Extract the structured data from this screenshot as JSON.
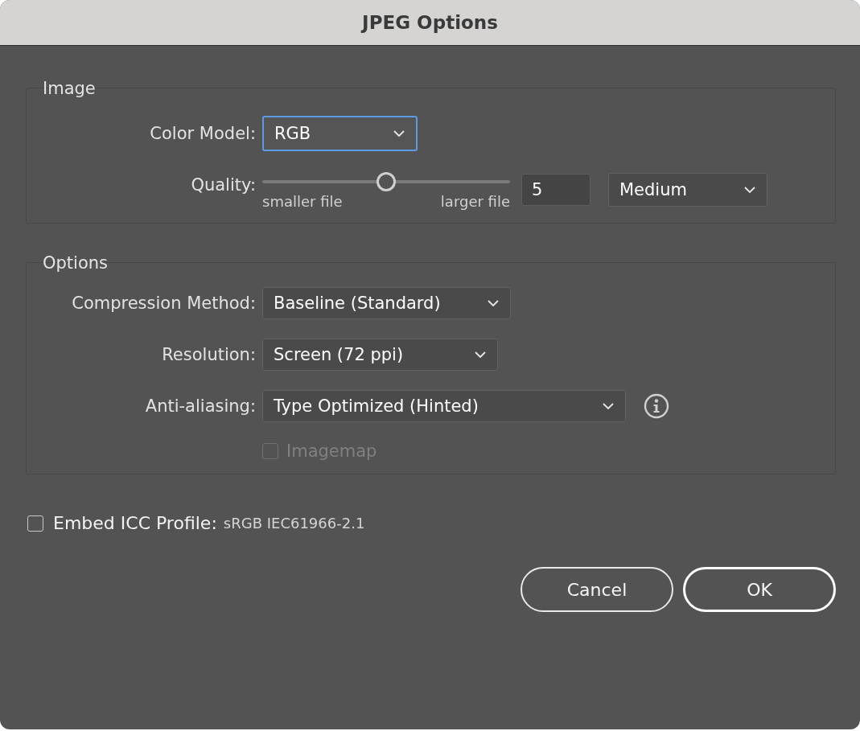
{
  "window": {
    "title": "JPEG Options"
  },
  "sections": [
    {
      "title": "Image",
      "rows": [
        {
          "kind": "dropdown",
          "label": "Color Model:",
          "value": "RGB",
          "focused": true
        },
        {
          "kind": "slider",
          "label": "Quality:",
          "level": 0.5,
          "min_label": "smaller file",
          "max_label": "larger file",
          "value": "5",
          "preset": "Medium"
        }
      ]
    },
    {
      "title": "Options",
      "rows": [
        {
          "kind": "dropdown",
          "label": "Compression Method:",
          "value": "Baseline (Standard)",
          "focused": false
        },
        {
          "kind": "dropdown",
          "label": "Resolution:",
          "value": "Screen (72 ppi)",
          "focused": false
        },
        {
          "kind": "dropdown",
          "label": "Anti-aliasing:",
          "value": "Type Optimized (Hinted)",
          "focused": false,
          "info": true
        },
        {
          "kind": "checkbox",
          "label": "Imagemap",
          "checked": false,
          "disabled": true
        }
      ]
    }
  ],
  "embed": {
    "label": "Embed ICC Profile:",
    "profile": "sRGB IEC61966-2.1",
    "checked": false
  },
  "buttons": [
    {
      "label": "Cancel",
      "default": false
    },
    {
      "label": "OK",
      "default": true
    }
  ]
}
